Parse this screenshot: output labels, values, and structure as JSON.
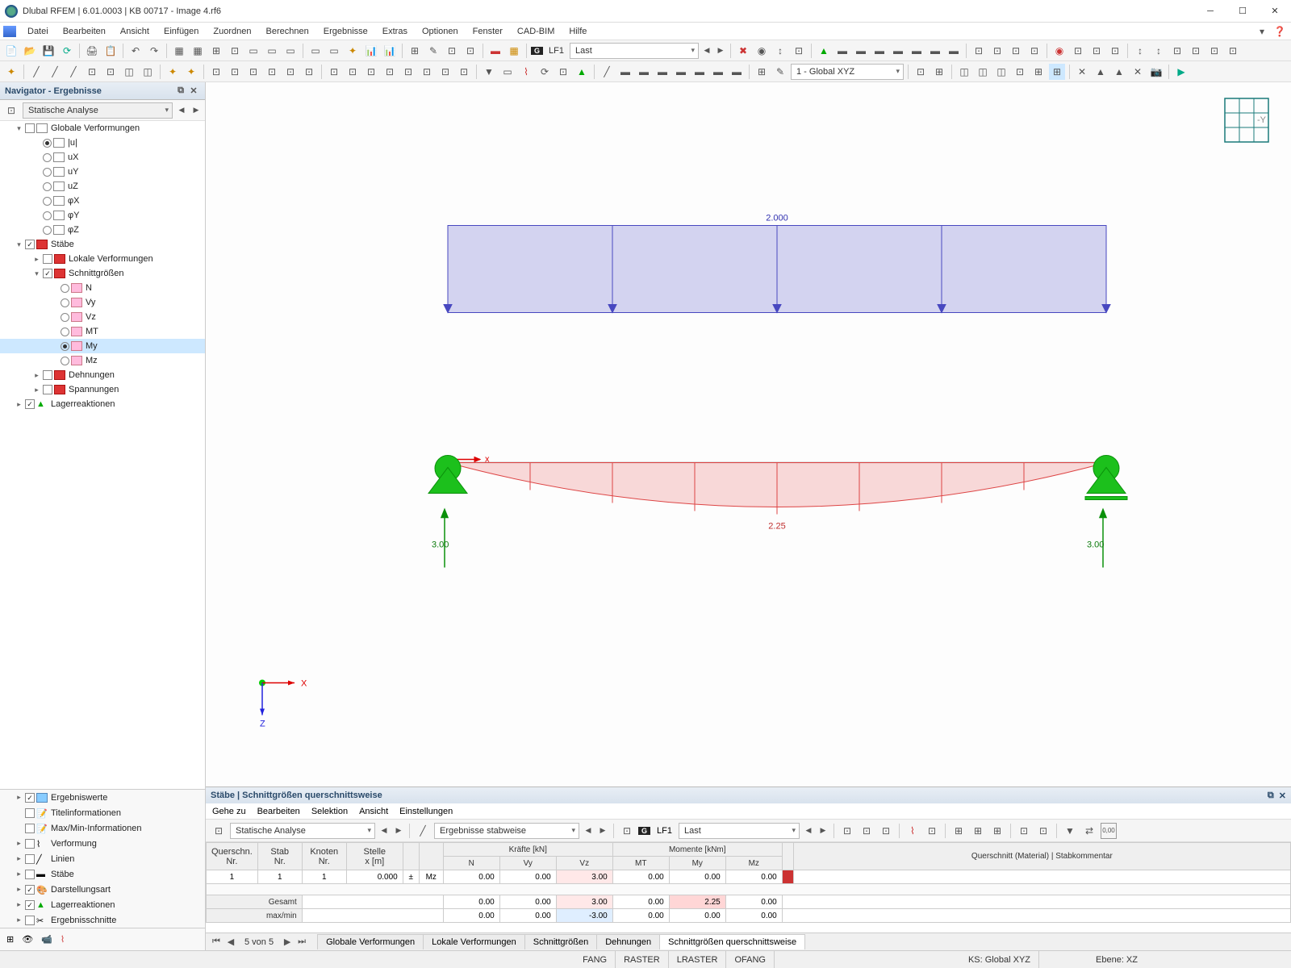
{
  "title": "Dlubal RFEM | 6.01.0003 | KB 00717 - Image 4.rf6",
  "menu": [
    "Datei",
    "Bearbeiten",
    "Ansicht",
    "Einfügen",
    "Zuordnen",
    "Berechnen",
    "Ergebnisse",
    "Extras",
    "Optionen",
    "Fenster",
    "CAD-BIM",
    "Hilfe"
  ],
  "toolbar1": {
    "lc_badge": "G",
    "lc_code": "LF1",
    "lc_name": "Last"
  },
  "toolbar2": {
    "coord_system": "1 - Global XYZ"
  },
  "navigator": {
    "title": "Navigator - Ergebnisse",
    "analysis": "Statische Analyse",
    "tree": {
      "globale_verf": "Globale Verformungen",
      "u": "|u|",
      "ux": "uX",
      "uy": "uY",
      "uz": "uZ",
      "phix": "φX",
      "phiy": "φY",
      "phiz": "φZ",
      "staebe": "Stäbe",
      "lokale_verf": "Lokale Verformungen",
      "schnitt": "Schnittgrößen",
      "n": "N",
      "vy": "Vy",
      "vz": "Vz",
      "mt": "MT",
      "my": "My",
      "mz": "Mz",
      "dehnungen": "Dehnungen",
      "spannungen": "Spannungen",
      "lager": "Lagerreaktionen"
    },
    "bottom": [
      "Ergebniswerte",
      "Titelinformationen",
      "Max/Min-Informationen",
      "Verformung",
      "Linien",
      "Stäbe",
      "Darstellungsart",
      "Lagerreaktionen",
      "Ergebnisschnitte"
    ]
  },
  "canvas": {
    "load_value": "2.000",
    "moment_max": "2.25",
    "reaction_left": "3.00",
    "reaction_right": "3.00",
    "axis_x": "X",
    "axis_z": "Z",
    "gizmo_y": "-Y"
  },
  "panel": {
    "title": "Stäbe | Schnittgrößen querschnittsweise",
    "menu": [
      "Gehe zu",
      "Bearbeiten",
      "Selektion",
      "Ansicht",
      "Einstellungen"
    ],
    "analysis": "Statische Analyse",
    "results_mode": "Ergebnisse stabweise",
    "lc_badge": "G",
    "lc_code": "LF1",
    "lc_name": "Last",
    "headers": {
      "querschn": "Querschn.",
      "nr": "Nr.",
      "stab": "Stab",
      "knoten": "Knoten",
      "stelle": "Stelle",
      "xm": "x [m]",
      "kraefte": "Kräfte [kN]",
      "n": "N",
      "vy": "Vy",
      "vz": "Vz",
      "momente": "Momente [kNm]",
      "mt": "MT",
      "my": "My",
      "mz": "Mz",
      "kommentar": "Querschnitt (Material) | Stabkommentar",
      "gesamt": "Gesamt",
      "maxmin": "max/min"
    },
    "row1": {
      "q": "1",
      "s": "1",
      "k": "1",
      "x": "0.000",
      "sym": "±",
      "col": "Mz",
      "n": "0.00",
      "vy": "0.00",
      "vz": "3.00",
      "mt": "0.00",
      "my": "0.00",
      "mz": "0.00"
    },
    "gesamt": {
      "n": "0.00",
      "vy": "0.00",
      "vz": "3.00",
      "mt": "0.00",
      "my": "2.25",
      "mz": "0.00"
    },
    "maxmin": {
      "n": "0.00",
      "vy": "0.00",
      "vz": "-3.00",
      "mt": "0.00",
      "my": "0.00",
      "mz": "0.00"
    },
    "page": "5 von 5",
    "tabs": [
      "Globale Verformungen",
      "Lokale Verformungen",
      "Schnittgrößen",
      "Dehnungen",
      "Schnittgrößen querschnittsweise"
    ]
  },
  "status": {
    "fang": "FANG",
    "raster": "RASTER",
    "lraster": "LRASTER",
    "ofang": "OFANG",
    "ks": "KS: Global XYZ",
    "ebene": "Ebene: XZ"
  }
}
